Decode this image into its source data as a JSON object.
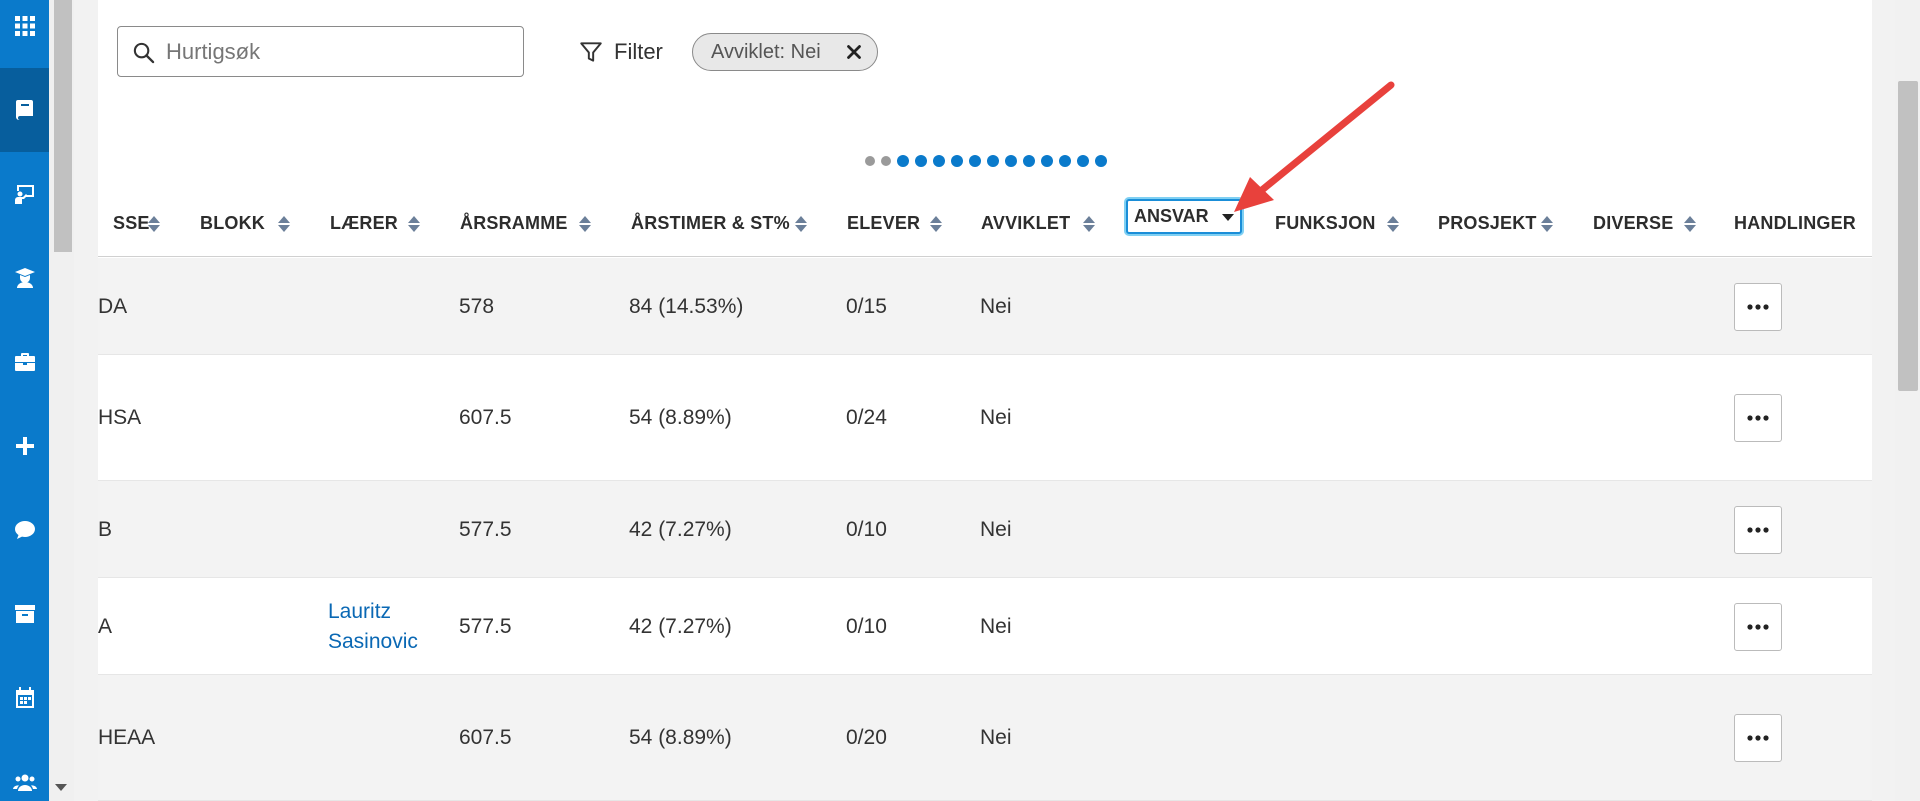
{
  "nav": {
    "items": [
      {
        "icon": "apps-grid-icon",
        "active": false
      },
      {
        "icon": "book-icon",
        "active": true
      },
      {
        "icon": "teacher-board-icon",
        "active": false
      },
      {
        "icon": "student-graduate-icon",
        "active": false
      },
      {
        "icon": "briefcase-icon",
        "active": false
      },
      {
        "icon": "plus-icon",
        "active": false
      },
      {
        "icon": "chat-bubble-icon",
        "active": false
      },
      {
        "icon": "archive-box-icon",
        "active": false
      },
      {
        "icon": "calendar-icon",
        "active": false
      },
      {
        "icon": "users-group-icon",
        "active": false
      }
    ],
    "color": "#0a7acb",
    "active_color": "#075e9d"
  },
  "toolbar": {
    "search_placeholder": "Hurtigsøk",
    "search_value": "",
    "filter_label": "Filter",
    "chip_label": "Avviklet: Nei"
  },
  "pagination": {
    "dots_total": 14,
    "dots_grey": 2
  },
  "table": {
    "headers": [
      "SSE",
      "BLOKK",
      "LÆRER",
      "ÅRSRAMME",
      "ÅRSTIMER & ST%",
      "ELEVER",
      "AVVIKLET",
      "ANSVAR",
      "FUNKSJON",
      "PROSJEKT",
      "DIVERSE",
      "HANDLINGER"
    ],
    "active_header": "ANSVAR",
    "rows": [
      {
        "klasse": "DA",
        "blokk": "",
        "laerer": "",
        "laerer2": "",
        "arsramme": "578",
        "arstimer": "84 (14.53%)",
        "elever": "0/15",
        "avviklet": "Nei"
      },
      {
        "klasse": "HSA",
        "blokk": "",
        "laerer": "",
        "laerer2": "",
        "arsramme": "607.5",
        "arstimer": "54 (8.89%)",
        "elever": "0/24",
        "avviklet": "Nei"
      },
      {
        "klasse": "B",
        "blokk": "",
        "laerer": "",
        "laerer2": "",
        "arsramme": "577.5",
        "arstimer": "42 (7.27%)",
        "elever": "0/10",
        "avviklet": "Nei"
      },
      {
        "klasse": "A",
        "blokk": "",
        "laerer": "Lauritz",
        "laerer2": "Sasinovic",
        "arsramme": "577.5",
        "arstimer": "42 (7.27%)",
        "elever": "0/10",
        "avviklet": "Nei"
      },
      {
        "klasse": "HEAA",
        "blokk": "",
        "laerer": "",
        "laerer2": "",
        "arsramme": "607.5",
        "arstimer": "54 (8.89%)",
        "elever": "0/20",
        "avviklet": "Nei"
      }
    ]
  },
  "annotation": {
    "color": "#e8413c",
    "icon": "red-arrow-pointer"
  },
  "colors": {
    "accent": "#0a7acb",
    "link": "#0a68b4",
    "focus": "#1a8ed8"
  }
}
